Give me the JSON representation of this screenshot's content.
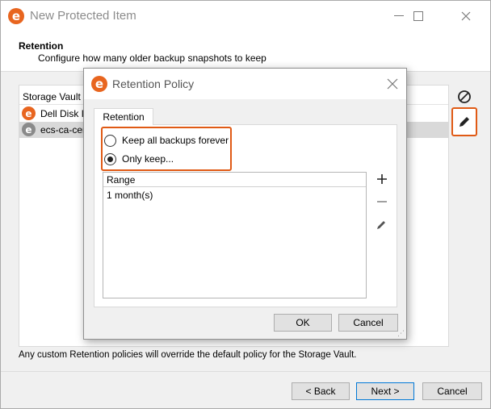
{
  "window": {
    "title": "New Protected Item",
    "icon_letter": "e"
  },
  "header": {
    "title": "Retention",
    "subtitle": "Configure how many older backup snapshots to keep"
  },
  "vault_list": {
    "column_header": "Storage Vault",
    "items": [
      {
        "label": "Dell Disk In"
      },
      {
        "label": "ecs-ca-cent"
      }
    ]
  },
  "side_tools": {
    "clear_icon": "⊘",
    "edit_icon": "✎"
  },
  "info_text": "Any custom Retention policies will override the default policy for the Storage Vault.",
  "footer": {
    "back_label": "< Back",
    "next_label": "Next >",
    "cancel_label": "Cancel"
  },
  "dialog": {
    "title": "Retention Policy",
    "tab_label": "Retention",
    "radio_keep_forever": "Keep all backups forever",
    "radio_only_keep": "Only keep...",
    "range_header": "Range",
    "range_rows": [
      "1 month(s)"
    ],
    "add_icon": "+",
    "remove_icon": "−",
    "edit_icon": "✎",
    "ok_label": "OK",
    "cancel_label": "Cancel"
  },
  "colors": {
    "accent": "#e05a15",
    "app_icon": "#e8651f"
  }
}
